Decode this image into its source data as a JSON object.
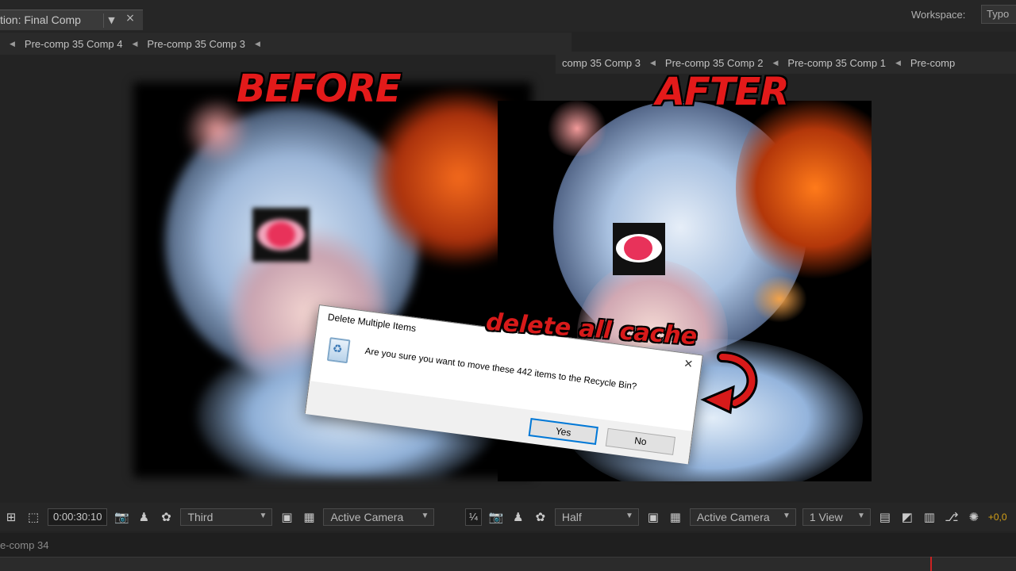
{
  "panel": {
    "title": "tion: Final Comp",
    "menu_glyph": "▼",
    "close_glyph": "×"
  },
  "workspace": {
    "label": "Workspace:",
    "value": "Typo"
  },
  "breadcrumbs_left": [
    "Pre-comp 35 Comp 4",
    "Pre-comp 35 Comp 3"
  ],
  "breadcrumbs_right": [
    "comp 35 Comp 3",
    "Pre-comp 35 Comp 2",
    "Pre-comp 35 Comp 1",
    "Pre-comp"
  ],
  "labels": {
    "before": "BEFORE",
    "after": "AFTER",
    "overlay": "delete all cache"
  },
  "dialog": {
    "title": "Delete Multiple Items",
    "message": "Are you sure you want to move these 442 items to the Recycle Bin?",
    "yes": "Yes",
    "no": "No",
    "close_glyph": "✕"
  },
  "toolbar_left": {
    "timecode": "0:00:30:10",
    "resolution": "Third",
    "camera": "Active Camera"
  },
  "toolbar_right": {
    "zoom_ratio": "¼",
    "resolution": "Half",
    "camera": "Active Camera",
    "view": "1 View",
    "exposure": "+0,0"
  },
  "bottom": {
    "label": "e-comp 34"
  },
  "colors": {
    "label_red": "#e31a1a",
    "iris_pink": "#e8325a",
    "ui_dark": "#232323"
  }
}
